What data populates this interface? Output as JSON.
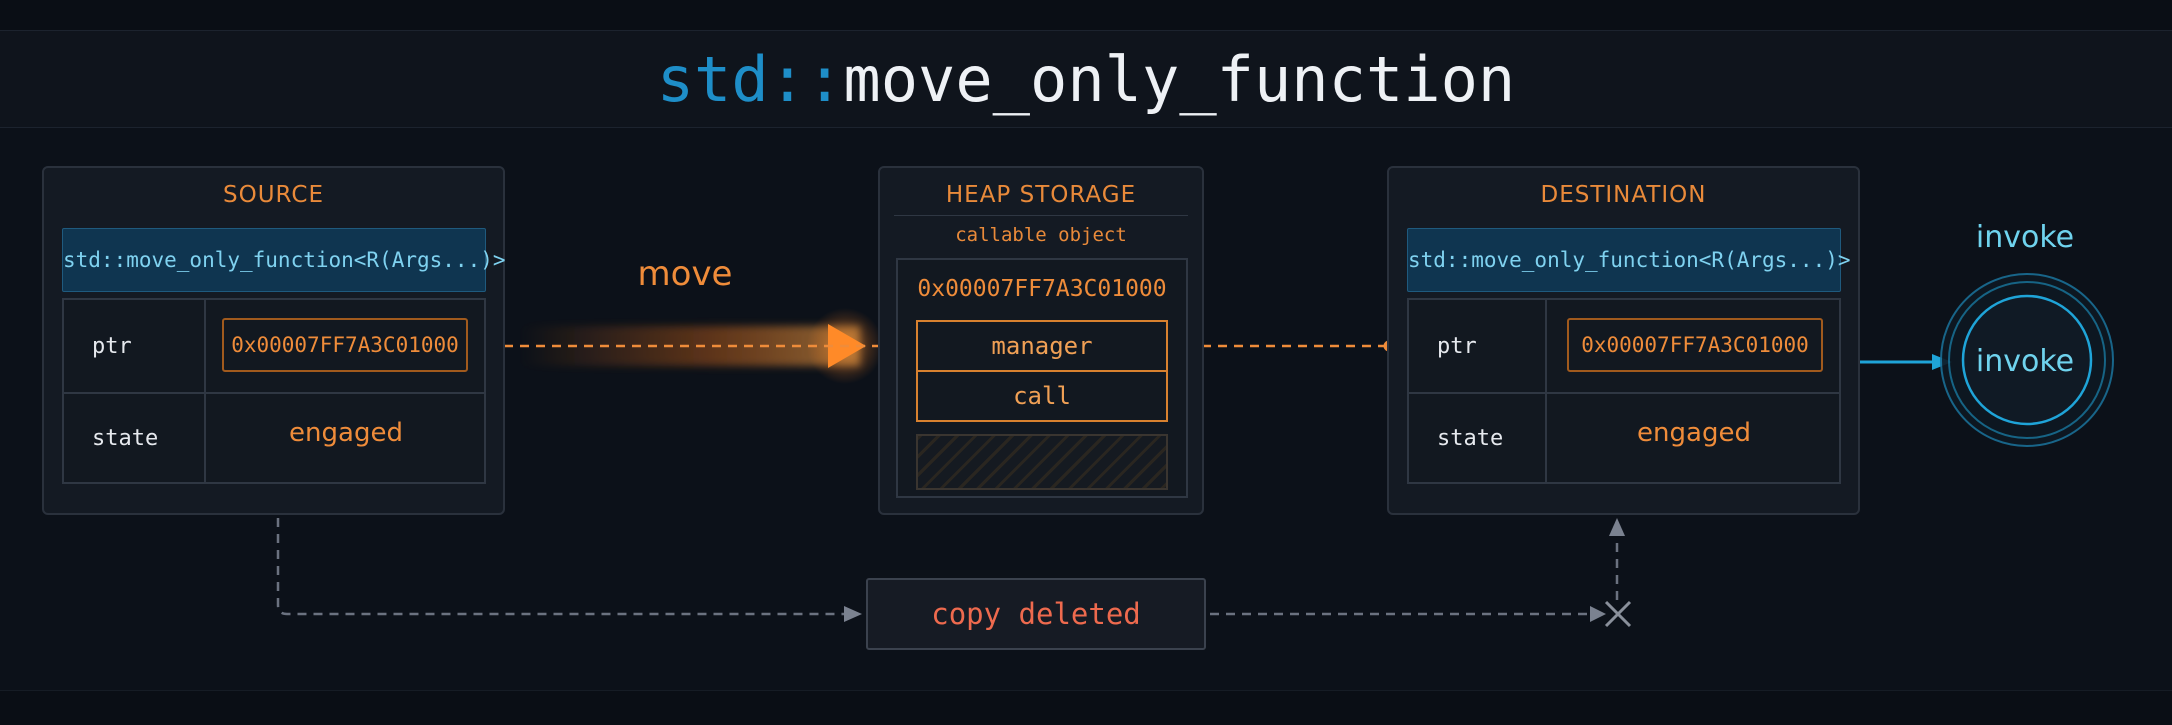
{
  "title": {
    "namespace": "std::",
    "name": "move_only_function"
  },
  "source": {
    "heading": "SOURCE",
    "type": "std::move_only_function<R(Args...)>",
    "rows": [
      {
        "label": "ptr",
        "value": "0x00007FF7A3C01000"
      },
      {
        "label": "state",
        "value": "engaged"
      }
    ]
  },
  "heap": {
    "heading": "HEAP STORAGE",
    "subheading": "callable object",
    "address": "0x00007FF7A3C01000",
    "slots": [
      "manager",
      "call"
    ]
  },
  "destination": {
    "heading": "DESTINATION",
    "type": "std::move_only_function<R(Args...)>",
    "rows": [
      {
        "label": "ptr",
        "value": "0x00007FF7A3C01000"
      },
      {
        "label": "state",
        "value": "engaged"
      }
    ]
  },
  "move_label": "move",
  "invoke": {
    "label_top": "invoke",
    "label_circle": "invoke"
  },
  "copy_deleted": "copy deleted",
  "colors": {
    "accent": "#ef8c3a",
    "namespace": "#1e8ec8",
    "invoke": "#1fa4d8",
    "error": "#ee6a4e"
  }
}
